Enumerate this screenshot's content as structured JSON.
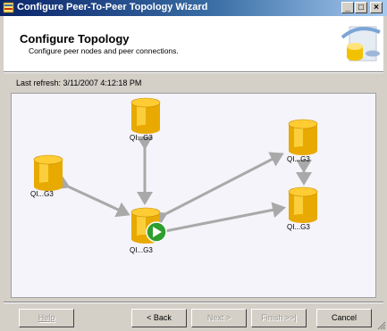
{
  "window": {
    "title": "Configure Peer-To-Peer Topology Wizard",
    "controls": {
      "minimize": "_",
      "maximize": "□",
      "close": "×"
    }
  },
  "header": {
    "title": "Configure Topology",
    "subtitle": "Configure peer nodes and peer connections."
  },
  "status": {
    "last_refresh": "Last refresh: 3/11/2007 4:12:18 PM"
  },
  "topology": {
    "nodes": [
      {
        "id": "n1",
        "label": "QI...G3"
      },
      {
        "id": "n2",
        "label": "QI...G3"
      },
      {
        "id": "n3",
        "label": "QI...G3"
      },
      {
        "id": "n4",
        "label": "QI...G3"
      },
      {
        "id": "n5",
        "label": "QI...G3"
      }
    ],
    "colors": {
      "db_body": "#e8a900",
      "db_highlight": "#ffd84a",
      "db_top": "#ffcc33",
      "connection": "#a9a9a9",
      "status_icon": "#2e9e2e"
    }
  },
  "buttons": {
    "help": "Help",
    "back": "< Back",
    "next": "Next >",
    "finish": "Finish >>|",
    "cancel": "Cancel"
  }
}
